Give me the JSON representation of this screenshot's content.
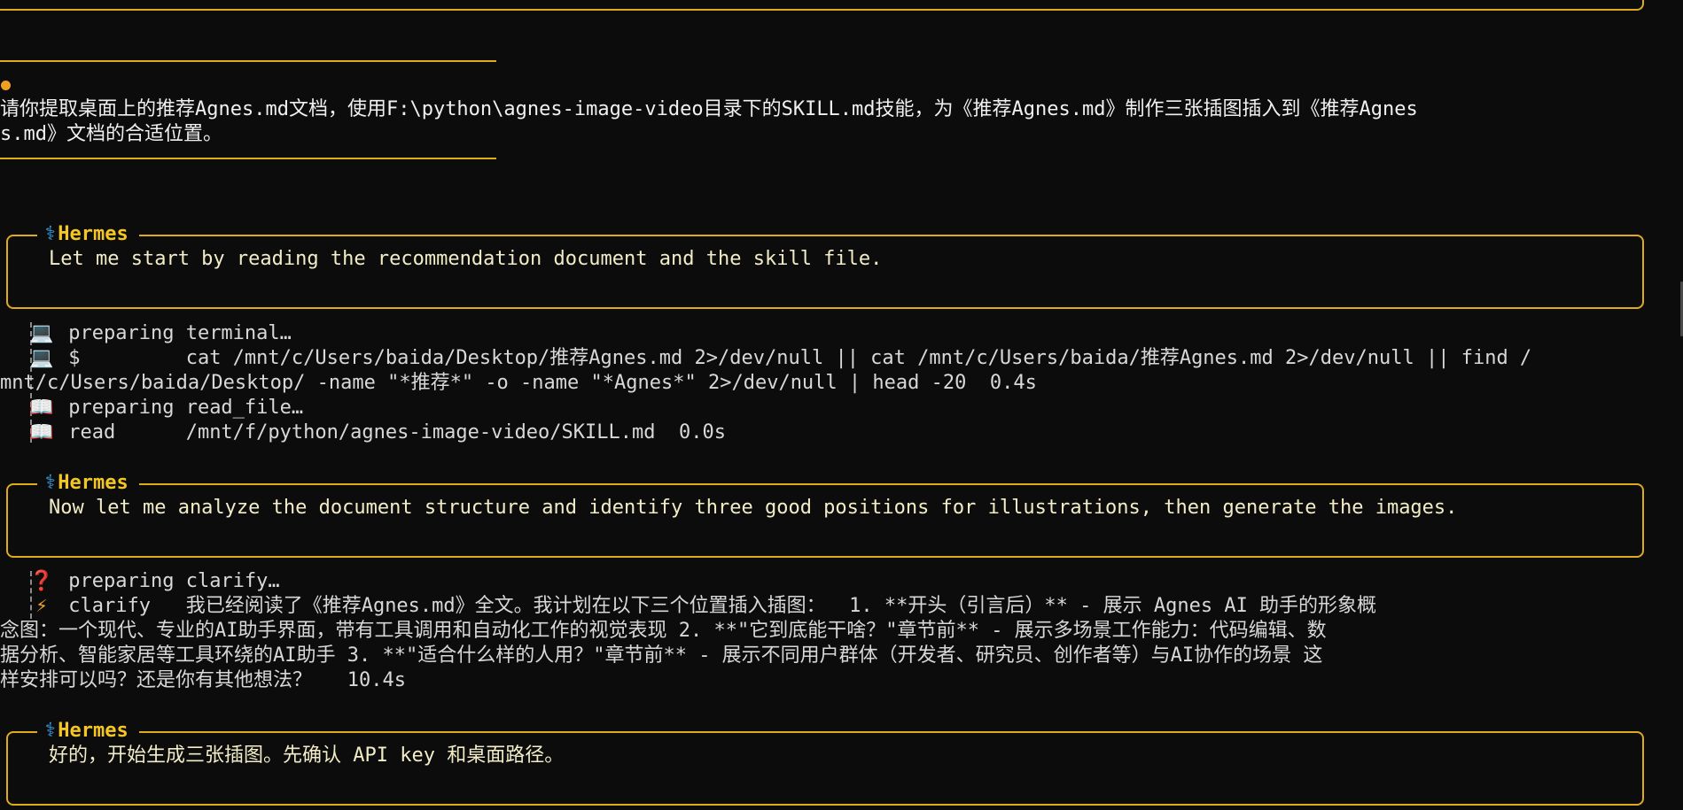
{
  "user_message": {
    "line1": "请你提取桌面上的推荐Agnes.md文档，使用F:\\python\\agnes-image-video目录下的SKILL.md技能，为《推荐Agnes.md》制作三张插图插入到《推荐Agnes",
    "line2": "s.md》文档的合适位置。"
  },
  "blocks": [
    {
      "sender_icon": "⚕",
      "sender": "Hermes",
      "reply": "Let me start by reading the recommendation document and the skill file."
    },
    {
      "sender_icon": "⚕",
      "sender": "Hermes",
      "reply": "Now let me analyze the document structure and identify three good positions for illustrations, then generate the images."
    },
    {
      "sender_icon": "⚕",
      "sender": "Hermes",
      "reply": "好的，开始生成三张插图。先确认 API key 和桌面路径。"
    }
  ],
  "tools_1": {
    "terminal_preparing": "preparing terminal…",
    "terminal_cmd_line1": "$         cat /mnt/c/Users/baida/Desktop/推荐Agnes.md 2>/dev/null || cat /mnt/c/Users/baida/推荐Agnes.md 2>/dev/null || find /",
    "terminal_cmd_line2": "mnt/c/Users/baida/Desktop/ -name \"*推荐*\" -o -name \"*Agnes*\" 2>/dev/null | head -20  0.4s",
    "read_preparing": "preparing read_file…",
    "read_line": "read      /mnt/f/python/agnes-image-video/SKILL.md  0.0s"
  },
  "tools_2": {
    "clarify_preparing": "preparing clarify…",
    "clarify_line1": "clarify   我已经阅读了《推荐Agnes.md》全文。我计划在以下三个位置插入插图：  1. **开头（引言后）** - 展示 Agnes AI 助手的形象概",
    "clarify_line2": "念图：一个现代、专业的AI助手界面，带有工具调用和自动化工作的视觉表现 2. **\"它到底能干啥？\"章节前** - 展示多场景工作能力：代码编辑、数",
    "clarify_line3": "据分析、智能家居等工具环绕的AI助手 3. **\"适合什么样的人用？\"章节前** - 展示不同用户群体（开发者、研究员、创作者等）与AI协作的场景 这",
    "clarify_line4": "样安排可以吗？还是你有其他想法？   10.4s"
  },
  "icons": {
    "terminal": "laptop-icon",
    "read": "book-icon",
    "clarify_prep": "question-icon",
    "clarify": "bolt-icon",
    "sender": "caduceus-icon"
  },
  "colors": {
    "accent": "#e0ab1a",
    "sender": "#f3c623",
    "reply_text": "#f2edc6",
    "background": "#0c0c0c"
  }
}
